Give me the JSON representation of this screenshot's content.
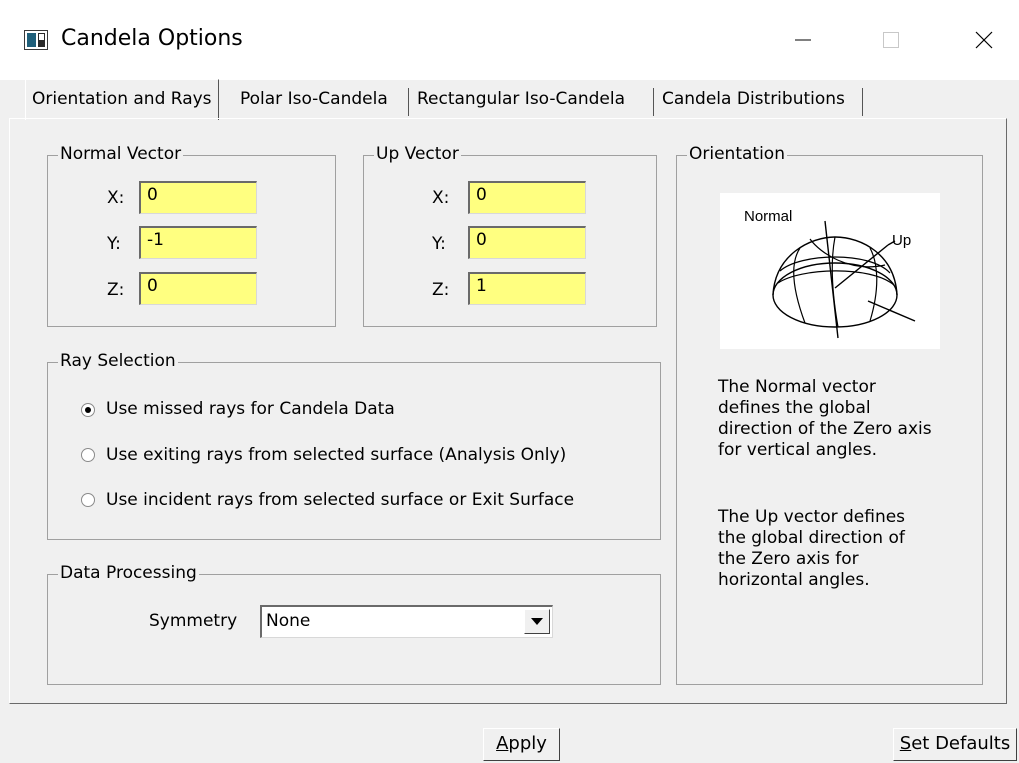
{
  "window": {
    "title": "Candela Options",
    "minimize_label": "—",
    "close_label": "✕"
  },
  "tabs": [
    {
      "label": "Orientation and Rays",
      "active": true
    },
    {
      "label": "Polar Iso-Candela",
      "active": false
    },
    {
      "label": "Rectangular Iso-Candela",
      "active": false
    },
    {
      "label": "Candela Distributions",
      "active": false
    }
  ],
  "normal_vector": {
    "title": "Normal Vector",
    "x_label": "X:",
    "x_value": "0",
    "y_label": "Y:",
    "y_value": "-1",
    "z_label": "Z:",
    "z_value": "0"
  },
  "up_vector": {
    "title": "Up Vector",
    "x_label": "X:",
    "x_value": "0",
    "y_label": "Y:",
    "y_value": "0",
    "z_label": "Z:",
    "z_value": "1"
  },
  "ray_selection": {
    "title": "Ray Selection",
    "options": [
      {
        "label": "Use missed rays for Candela Data",
        "checked": true
      },
      {
        "label": "Use exiting rays from selected surface (Analysis Only)",
        "checked": false
      },
      {
        "label": "Use incident rays from selected surface or Exit Surface",
        "checked": false
      }
    ]
  },
  "data_processing": {
    "title": "Data Processing",
    "symmetry_label": "Symmetry",
    "symmetry_value": "None"
  },
  "orientation": {
    "title": "Orientation",
    "diagram_normal_label": "Normal",
    "diagram_up_label": "Up",
    "normal_desc": [
      "The Normal vector",
      "defines the global",
      "direction of the Zero axis",
      "for vertical angles."
    ],
    "up_desc": [
      "The Up vector defines",
      "the global direction of",
      "the Zero axis for",
      "horizontal angles."
    ]
  },
  "buttons": {
    "apply_first": "A",
    "apply_rest": "pply",
    "defaults_first": "S",
    "defaults_rest": "et Defaults"
  },
  "colors": {
    "field_background": "#ffff80",
    "dialog_background": "#f0f0f0"
  }
}
